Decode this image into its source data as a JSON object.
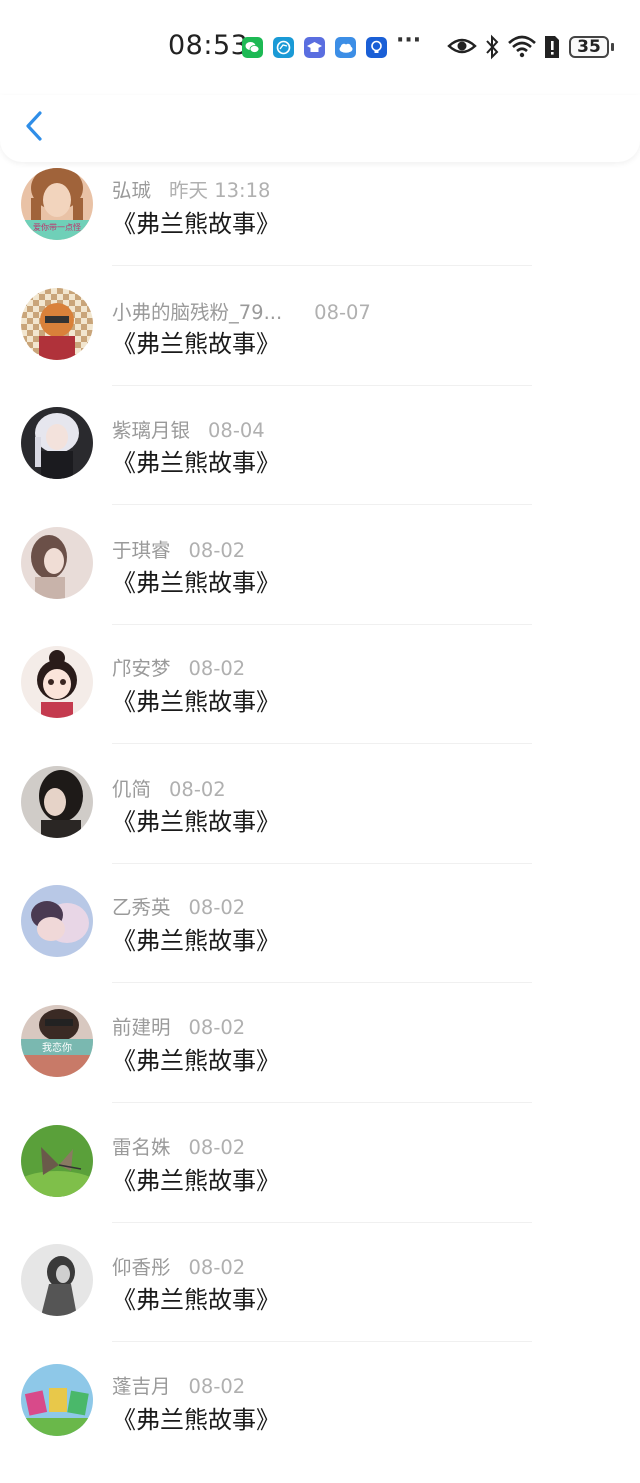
{
  "status_bar": {
    "time": "08:53",
    "app_icons": [
      "wechat-icon",
      "browser-icon",
      "education-icon",
      "cloud-icon",
      "bulb-icon"
    ],
    "more": "···",
    "battery": "35"
  },
  "header": {
    "back_icon": "chevron-left-icon",
    "accent_color": "#2f8ee8"
  },
  "comments": [
    {
      "name": "弘珹",
      "date": "昨天 13:18",
      "text": "《弗兰熊故事》",
      "avatar_text": "爱你带一点怪"
    },
    {
      "name": "小弗的脑残粉_79...",
      "date": "08-07",
      "text": "《弗兰熊故事》"
    },
    {
      "name": "紫璃月银",
      "date": "08-04",
      "text": "《弗兰熊故事》"
    },
    {
      "name": "于琪睿",
      "date": "08-02",
      "text": "《弗兰熊故事》"
    },
    {
      "name": "邝安梦",
      "date": "08-02",
      "text": "《弗兰熊故事》"
    },
    {
      "name": "仉简",
      "date": "08-02",
      "text": "《弗兰熊故事》"
    },
    {
      "name": "乙秀英",
      "date": "08-02",
      "text": "《弗兰熊故事》"
    },
    {
      "name": "前建明",
      "date": "08-02",
      "text": "《弗兰熊故事》",
      "avatar_text": "我恋你"
    },
    {
      "name": "雷名姝",
      "date": "08-02",
      "text": "《弗兰熊故事》"
    },
    {
      "name": "仰香彤",
      "date": "08-02",
      "text": "《弗兰熊故事》"
    },
    {
      "name": "蓬吉月",
      "date": "08-02",
      "text": "《弗兰熊故事》"
    }
  ]
}
